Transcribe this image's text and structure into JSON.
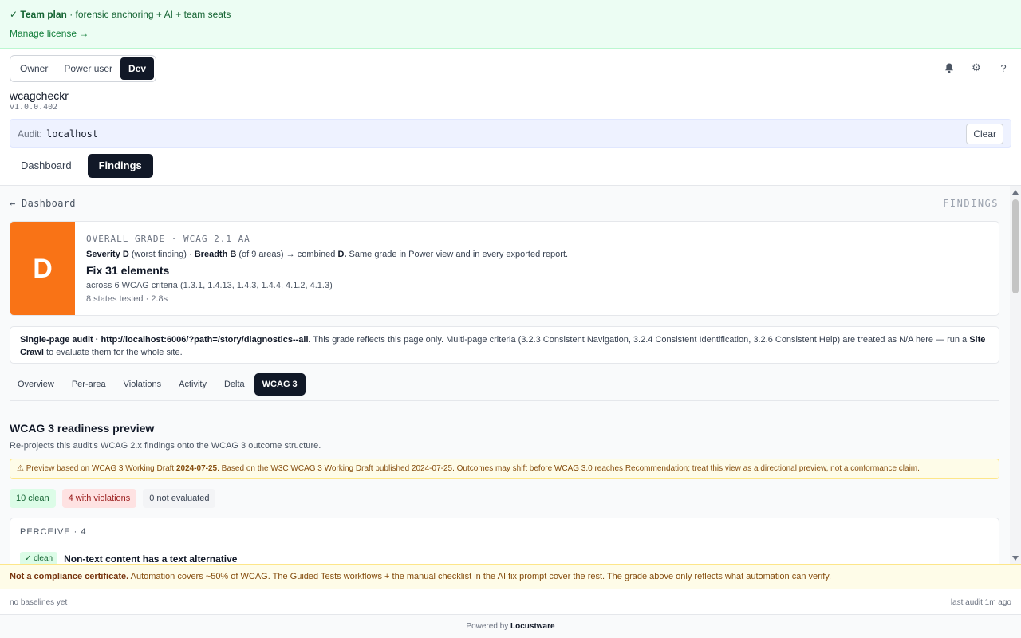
{
  "license": {
    "plan_check": "✓",
    "plan_name": "Team plan",
    "plan_desc": " · forensic anchoring + AI + team seats",
    "manage_link": "Manage license →"
  },
  "roles": [
    {
      "label": "Owner",
      "active": false
    },
    {
      "label": "Power user",
      "active": false
    },
    {
      "label": "Dev",
      "active": true
    }
  ],
  "icons": {
    "notifications": "bell-icon",
    "settings": "gear-icon",
    "help": "help-icon"
  },
  "app": {
    "name": "wcagcheckr",
    "version": "v1.0.0.402"
  },
  "audit": {
    "label": "Audit:",
    "target": "localhost",
    "clear_label": "Clear"
  },
  "main_tabs": [
    {
      "label": "Dashboard",
      "active": false
    },
    {
      "label": "Findings",
      "active": true
    }
  ],
  "findings": {
    "back_label": "← Dashboard",
    "section_label": "FINDINGS",
    "grade": {
      "letter": "D",
      "color": "#f97316",
      "overline": "OVERALL GRADE · WCAG 2.1 AA",
      "severity_label": "Severity D",
      "severity_note": " (worst finding) · ",
      "breadth_label": "Breadth B",
      "breadth_note": " (of 9 areas) → combined ",
      "combined": "D.",
      "tail": " Same grade in Power view and in every exported report.",
      "fix_title": "Fix 31 elements",
      "criteria": "across 6 WCAG criteria (1.3.1, 1.4.13, 1.4.3, 1.4.4, 4.1.2, 4.1.3)",
      "states": "8 states tested · 2.8s"
    },
    "scope_note": {
      "lead": "Single-page audit · http://localhost:6006/?path=/story/diagnostics--all.",
      "body": " This grade reflects this page only. Multi-page criteria (3.2.3 Consistent Navigation, 3.2.4 Consistent Identification, 3.2.6 Consistent Help) are treated as N/A here — run a ",
      "link": "Site Crawl",
      "tail": " to evaluate them for the whole site."
    },
    "sub_tabs": [
      {
        "label": "Overview",
        "active": false
      },
      {
        "label": "Per-area",
        "active": false
      },
      {
        "label": "Violations",
        "active": false
      },
      {
        "label": "Activity",
        "active": false
      },
      {
        "label": "Delta",
        "active": false
      },
      {
        "label": "WCAG 3",
        "active": true
      }
    ],
    "wcag3": {
      "title": "WCAG 3 readiness preview",
      "description": "Re-projects this audit's WCAG 2.x findings onto the WCAG 3 outcome structure.",
      "warning_prefix": "⚠ Preview based on WCAG 3 Working Draft ",
      "warning_date": "2024-07-25",
      "warning_body": ". Based on the W3C WCAG 3 Working Draft published 2024-07-25. Outcomes may shift before WCAG 3.0 reaches Recommendation; treat this view as a directional preview, not a conformance claim.",
      "chips": {
        "clean": "10 clean",
        "violations": "4 with violations",
        "not_evaluated": "0 not evaluated"
      },
      "group": {
        "heading": "PERCEIVE · 4",
        "rows": [
          {
            "badge": "✓ clean",
            "name": "Non-text content has a text alternative"
          }
        ]
      }
    }
  },
  "disclaimer": {
    "lead": "Not a compliance certificate.",
    "body": " Automation covers ~50% of WCAG. The Guided Tests workflows + the manual checklist in the AI fix prompt cover the rest. The grade above only reflects what automation can verify."
  },
  "footer": {
    "baselines": "no baselines yet",
    "last_audit": "last audit 1m ago",
    "powered_prefix": "Powered by ",
    "brand": "Locustware"
  }
}
